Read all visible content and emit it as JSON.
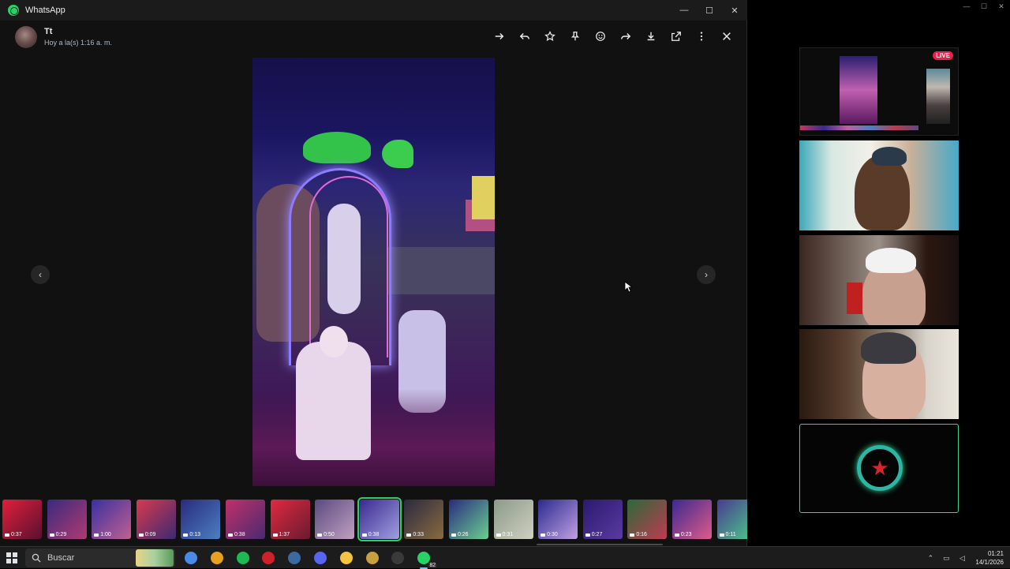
{
  "app": {
    "title": "WhatsApp"
  },
  "window_controls": {
    "minimize": "—",
    "maximize": "☐",
    "close": "✕"
  },
  "contact": {
    "name": "Tt",
    "time": "Hoy a la(s) 1:16 a. m."
  },
  "toolbar": {
    "items": [
      "forward-arrow-icon",
      "reply-icon",
      "star-icon",
      "pin-icon",
      "emoji-icon",
      "share-icon",
      "download-icon",
      "open-external-icon",
      "more-icon",
      "close-icon"
    ]
  },
  "viewer": {
    "prev": "‹",
    "next": "›"
  },
  "thumbnails": [
    {
      "duration": "0:37",
      "c1": "#e0203a",
      "c2": "#5a1030"
    },
    {
      "duration": "0:29",
      "c1": "#3a2a80",
      "c2": "#b03a70"
    },
    {
      "duration": "1:00",
      "c1": "#3a30a0",
      "c2": "#c06090"
    },
    {
      "duration": "0:09",
      "c1": "#d83a50",
      "c2": "#3a2a70"
    },
    {
      "duration": "0:13",
      "c1": "#2a2a80",
      "c2": "#4a80c0"
    },
    {
      "duration": "0:38",
      "c1": "#c0306a",
      "c2": "#4a2a70"
    },
    {
      "duration": "1:37",
      "c1": "#e02a40",
      "c2": "#6a1a30"
    },
    {
      "duration": "0:50",
      "c1": "#5a4a80",
      "c2": "#c0a0c0"
    },
    {
      "duration": "0:38",
      "c1": "#3a2a90",
      "c2": "#a0a0e0",
      "selected": true
    },
    {
      "duration": "0:33",
      "c1": "#2a2a40",
      "c2": "#8a6a40"
    },
    {
      "duration": "0:26",
      "c1": "#2a2a80",
      "c2": "#6ad090"
    },
    {
      "duration": "0:31",
      "c1": "#8a9a8a",
      "c2": "#d0d0c0"
    },
    {
      "duration": "0:30",
      "c1": "#2a2a90",
      "c2": "#c0a0e0"
    },
    {
      "duration": "0:27",
      "c1": "#2a1a70",
      "c2": "#5a3aa0"
    },
    {
      "duration": "0:16",
      "c1": "#2a6a3a",
      "c2": "#c03a50"
    },
    {
      "duration": "0:23",
      "c1": "#3a2a90",
      "c2": "#e05a8a"
    },
    {
      "duration": "0:11",
      "c1": "#4a3a90",
      "c2": "#4ad08a"
    }
  ],
  "stream": {
    "live_label": "LIVE"
  },
  "taskbar": {
    "search_placeholder": "Buscar",
    "apps": [
      {
        "name": "copilot-icon",
        "color": "#4a8ae8"
      },
      {
        "name": "chrome-icon",
        "color": "#e8a020"
      },
      {
        "name": "spotify-icon",
        "color": "#1db954"
      },
      {
        "name": "opera-icon",
        "color": "#d0202a"
      },
      {
        "name": "steam-icon",
        "color": "#3a6aa0"
      },
      {
        "name": "discord-icon",
        "color": "#5865f2"
      },
      {
        "name": "explorer-icon",
        "color": "#f2c440"
      },
      {
        "name": "league-icon",
        "color": "#c8a040"
      },
      {
        "name": "obs-icon",
        "color": "#3a3a3a"
      },
      {
        "name": "whatsapp-icon",
        "color": "#25d366",
        "badge": "82",
        "active": true
      }
    ],
    "time": "01:21",
    "date": "14/1/2026"
  }
}
